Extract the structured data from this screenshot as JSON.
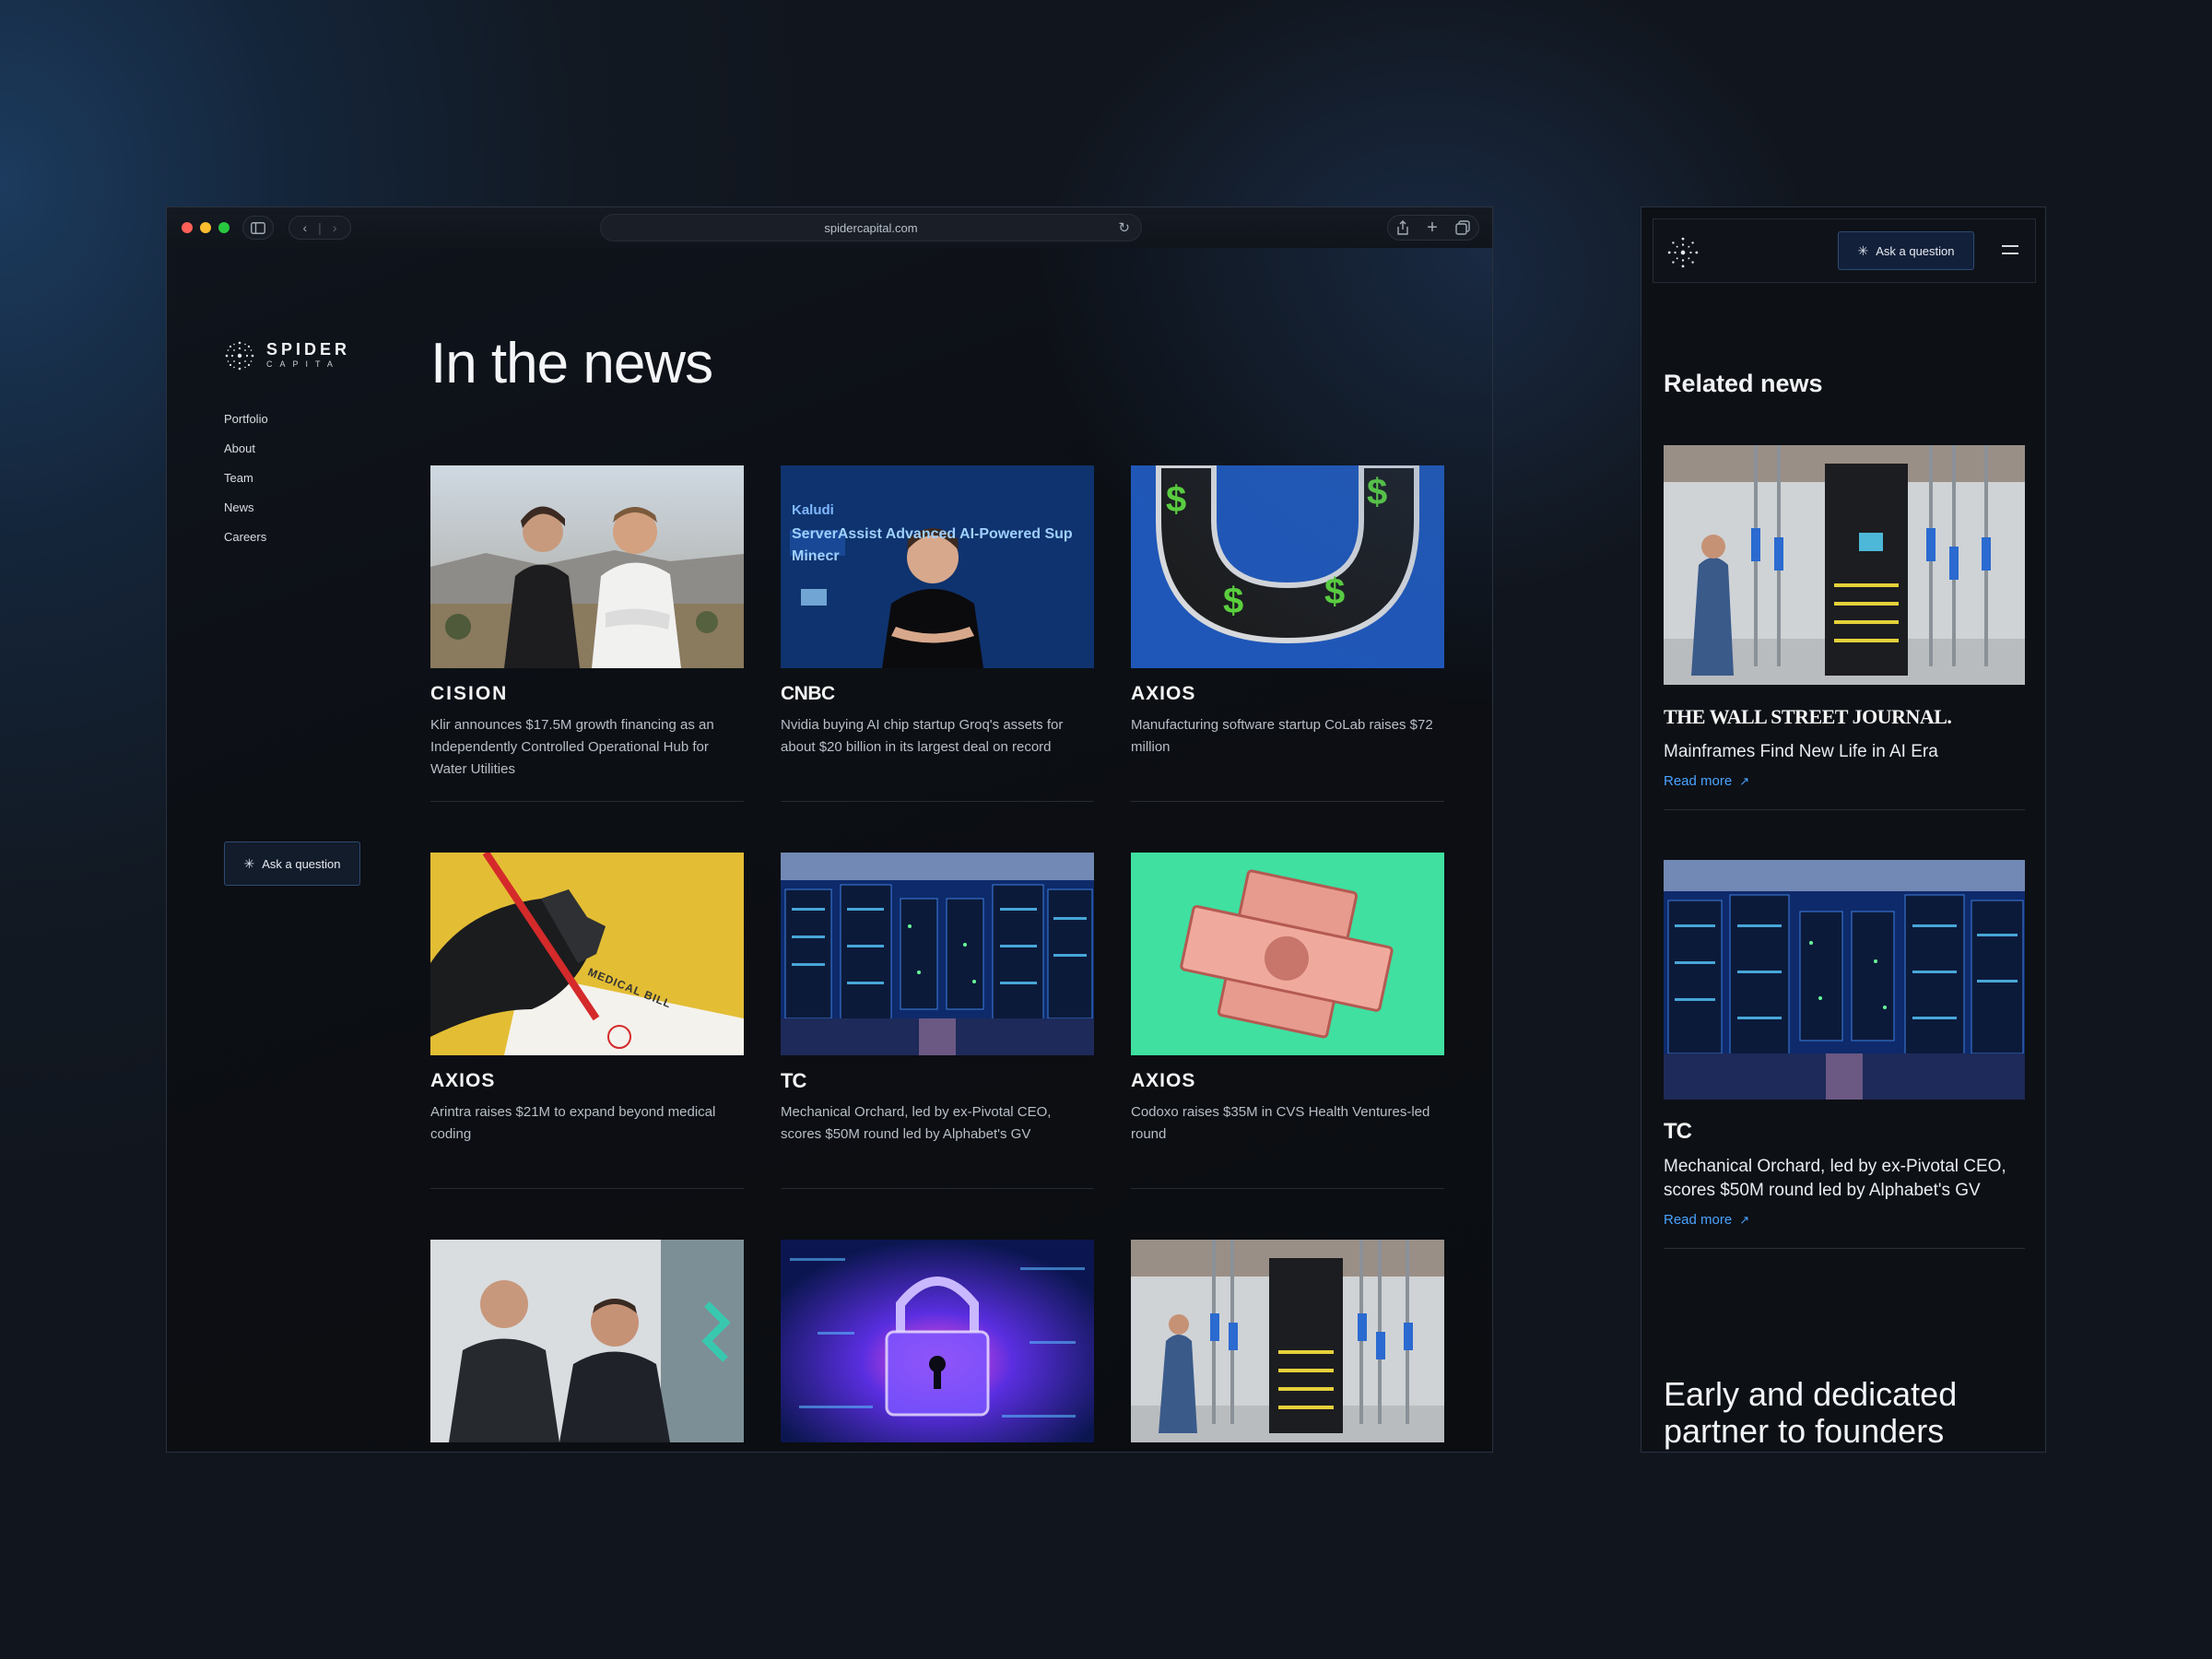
{
  "browser": {
    "url": "spidercapital.com"
  },
  "brand": {
    "line1": "SPIDER",
    "line2": "CAPITA"
  },
  "nav": {
    "items": [
      "Portfolio",
      "About",
      "Team",
      "News",
      "Careers"
    ]
  },
  "ask_button": {
    "label": "Ask a question"
  },
  "page": {
    "title": "In the news"
  },
  "news": [
    {
      "source": "CISION",
      "headline": "Klir announces $17.5M growth financing as an Independently Controlled Operational Hub for Water Utilities"
    },
    {
      "source": "CNBC",
      "headline": "Nvidia buying AI chip startup Groq's assets for about $20 billion in its largest deal on record"
    },
    {
      "source": "AXIOS",
      "headline": "Manufacturing software startup CoLab raises $72 million"
    },
    {
      "source": "AXIOS",
      "headline": "Arintra raises $21M to expand beyond medical coding"
    },
    {
      "source": "TC",
      "headline": "Mechanical Orchard, led by ex-Pivotal CEO, scores $50M round led by Alphabet's GV"
    },
    {
      "source": "AXIOS",
      "headline": "Codoxo raises $35M in CVS Health Ventures-led round"
    },
    {
      "source": "",
      "headline": ""
    },
    {
      "source": "",
      "headline": ""
    },
    {
      "source": "",
      "headline": ""
    }
  ],
  "image_text": {
    "cnbc_screen": "Kaludi",
    "cnbc_screen2": "ServerAssist Advanced AI-Powered Sup",
    "cnbc_screen3": "Minecr",
    "medical": "MEDICAL BILL"
  },
  "mobile": {
    "ask_label": "Ask a question",
    "section_title": "Related news",
    "cards": [
      {
        "source": "THE WALL STREET JOURNAL.",
        "headline": "Mainframes Find New Life in AI Era",
        "read_more": "Read more"
      },
      {
        "source": "TC",
        "headline": "Mechanical Orchard, led by ex-Pivotal CEO, scores $50M round led by Alphabet's GV",
        "read_more": "Read more"
      }
    ],
    "tagline": "Early and dedicated partner to founders"
  },
  "colors": {
    "accent_link": "#4aa3ff",
    "button_border": "#2e4a73",
    "background": "#11161e"
  },
  "icons": [
    "sidebar-toggle-icon",
    "back-arrow-icon",
    "forward-arrow-icon",
    "reload-icon",
    "share-icon",
    "new-tab-icon",
    "tabs-overview-icon",
    "spark-icon",
    "menu-icon",
    "arrow-up-right-icon"
  ]
}
